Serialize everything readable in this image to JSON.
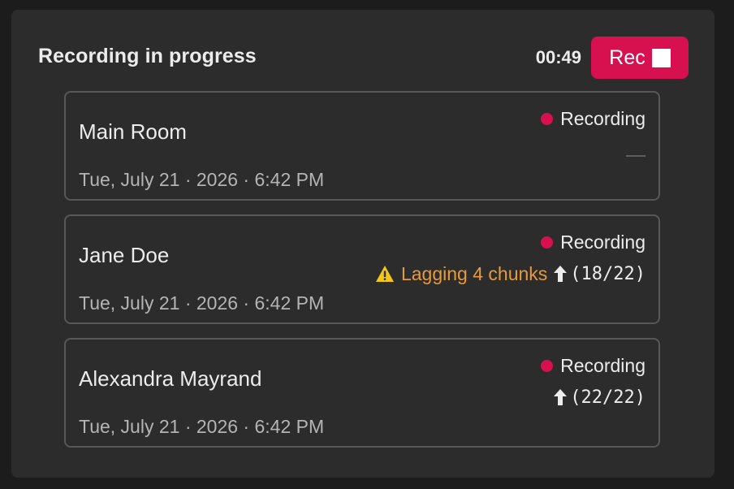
{
  "header": {
    "title": "Recording in progress",
    "timer": "00:49",
    "rec_label": "Rec"
  },
  "colors": {
    "accent": "#d7104f",
    "warning": "#e79a3c",
    "panel": "#2c2c2c"
  },
  "tracks": [
    {
      "name": "Main Room",
      "date": "Tue, July 21 · 2026 · 6:42 PM",
      "status": "Recording",
      "upload_placeholder": "—"
    },
    {
      "name": "Jane Doe",
      "date": "Tue, July 21 · 2026 · 6:42 PM",
      "status": "Recording",
      "warning": "Lagging 4 chunks",
      "upload_progress": "(18/22)"
    },
    {
      "name": "Alexandra Mayrand",
      "date": "Tue, July 21 · 2026 · 6:42 PM",
      "status": "Recording",
      "upload_progress": "(22/22)"
    }
  ],
  "icons": {
    "stop": "stop-icon",
    "recording_dot": "recording-dot-icon",
    "warning": "warning-icon",
    "upload": "upload-arrow-icon"
  }
}
